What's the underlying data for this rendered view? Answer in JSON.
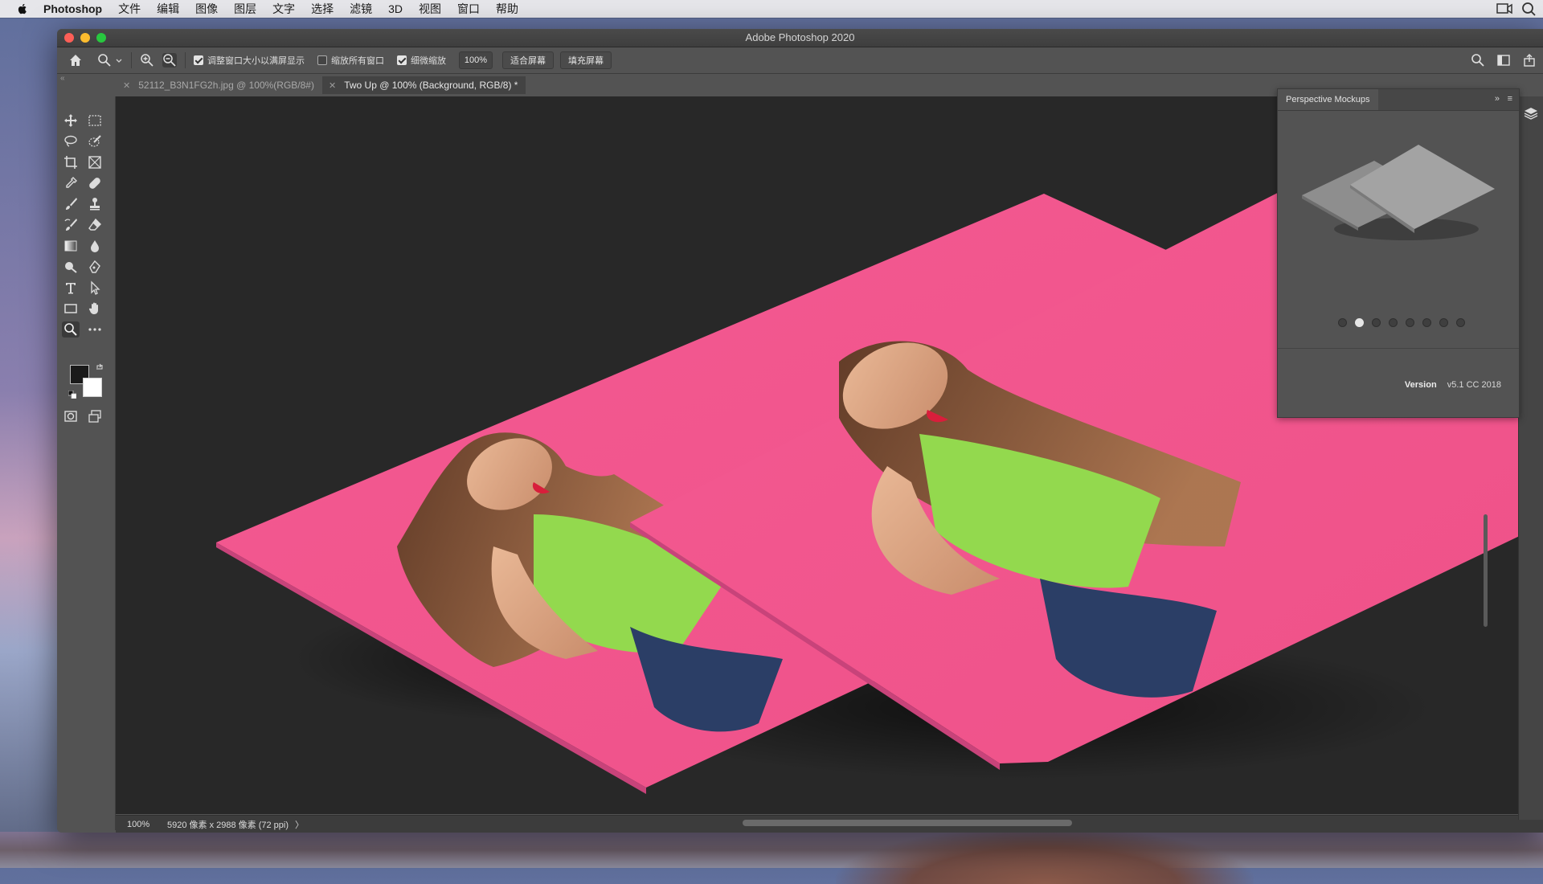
{
  "menubar": {
    "app_name": "Photoshop",
    "items": [
      "文件",
      "编辑",
      "图像",
      "图层",
      "文字",
      "选择",
      "滤镜",
      "3D",
      "视图",
      "窗口",
      "帮助"
    ]
  },
  "window": {
    "title": "Adobe Photoshop 2020"
  },
  "options_bar": {
    "checkbox_resize": {
      "label": "调整窗口大小以满屏显示",
      "checked": true
    },
    "checkbox_zoom_all": {
      "label": "缩放所有窗口",
      "checked": false
    },
    "checkbox_scrubby": {
      "label": "细微缩放",
      "checked": true
    },
    "zoom_value": "100%",
    "fit_screen": "适合屏幕",
    "fill_screen": "填充屏幕"
  },
  "tabs": [
    {
      "label": "52112_B3N1FG2h.jpg @ 100%(RGB/8#)",
      "active": false
    },
    {
      "label": "Two Up @ 100% (Background, RGB/8) *",
      "active": true
    }
  ],
  "toolbar": {
    "foreground_color": "#1a1a1a",
    "background_color": "#ffffff",
    "selected_tool": "zoom-tool"
  },
  "panel": {
    "title": "Perspective Mockups",
    "page_count": 8,
    "active_page": 2,
    "version_label": "Version",
    "version_value": "v5.1 CC 2018"
  },
  "status": {
    "zoom": "100%",
    "document_size": "5920 像素 x 2988 像素 (72 ppi)",
    "chevron": "〉"
  },
  "colors": {
    "mockup_pink": "#f05a8e",
    "canvas_bg": "#282828"
  }
}
